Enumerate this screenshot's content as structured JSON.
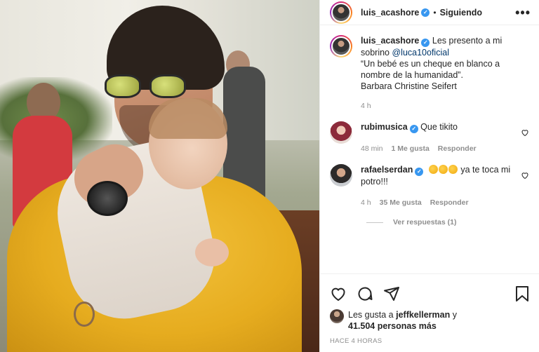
{
  "post": {
    "author": "luis_acashore",
    "follow_status": "Siguiendo",
    "more_label": "•••"
  },
  "caption": {
    "author": "luis_acashore",
    "text_before": " Les presento a mi sobrino ",
    "mention": "@luca10oficial",
    "quote": "“Un bebé es un cheque en blanco a nombre de la humanidad”.",
    "attribution": "Barbara Christine Seifert",
    "time": "4 h"
  },
  "comments": [
    {
      "author": "rubimusica",
      "text": "Que tikito",
      "time": "48 min",
      "likes": "1 Me gusta",
      "reply": "Responder"
    },
    {
      "author": "rafaelserdan",
      "text": " ya te toca mi potro!!!",
      "time": "4 h",
      "likes": "35 Me gusta",
      "reply": "Responder"
    }
  ],
  "view_replies": "Ver respuestas (1)",
  "likes": {
    "prefix": "Les gusta a ",
    "user": "jeffkellerman",
    "suffix": " y",
    "others": "41.504 personas más"
  },
  "timestamp": "HACE 4 HORAS",
  "colors": {
    "verified": "#3897f0",
    "mention": "#00376b",
    "secondary_text": "#8e8e8e"
  },
  "icons": [
    "heart-icon",
    "comment-icon",
    "share-icon",
    "bookmark-icon"
  ]
}
